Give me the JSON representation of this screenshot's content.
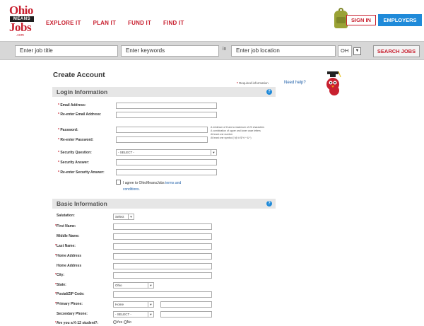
{
  "header": {
    "logo": {
      "line1": "Ohio",
      "line2": "MEANS",
      "line3": "Jobs",
      "line4": ".com"
    },
    "nav": [
      "EXPLORE IT",
      "PLAN IT",
      "FUND IT",
      "FIND IT"
    ],
    "sign_in": "SIGN IN",
    "employers": "EMPLOYERS"
  },
  "search": {
    "job_title": "Enter job title",
    "keywords": "Enter keywords",
    "in_label": "in",
    "location": "Enter job location",
    "state": "OH",
    "button": "SEARCH JOBS"
  },
  "page": {
    "title": "Create Account",
    "required_note": "Required information"
  },
  "help": {
    "text": "Need help?"
  },
  "login": {
    "heading": "Login Information",
    "email_label": "Email Address:",
    "reemail_label": "Re-enter Email Address:",
    "password_label": "Password:",
    "repassword_label": "Re-enter Password:",
    "security_q_label": "Security Question:",
    "security_q_value": "- SELECT -",
    "security_a_label": "Security Answer:",
    "resecurity_a_label": "Re-enter Security Answer:",
    "pw_help": [
      "A minimum of 8 and a maximum of 20 characters",
      "A combination of upper and lower case letters",
      "At least one number",
      "At least one symbol (! @ # $ % ^ & *)"
    ],
    "agree_text": "I agree to OhioMeansJobs",
    "agree_link": "terms and conditions."
  },
  "basic": {
    "heading": "Basic Information",
    "salutation_label": "Salutation:",
    "salutation_value": "Select",
    "first_name_label": "First Name:",
    "middle_name_label": "Middle Name:",
    "last_name_label": "Last Name:",
    "home_address_label": "Home Address",
    "home_address2_label": "Home Address",
    "city_label": "City:",
    "state_label": "State:",
    "state_value": "Ohio",
    "zip_label": "Postal/ZIP Code:",
    "primary_phone_label": "Primary Phone:",
    "primary_phone_type": "Home",
    "secondary_phone_label": "Secondary Phone:",
    "secondary_phone_type": "- SELECT -",
    "k12_label": "Are you a K-12 student?:",
    "k12_yes": "Yes",
    "k12_no": "No"
  },
  "colors": {
    "brand_red": "#c8202f",
    "brand_blue": "#1f8ad9"
  }
}
